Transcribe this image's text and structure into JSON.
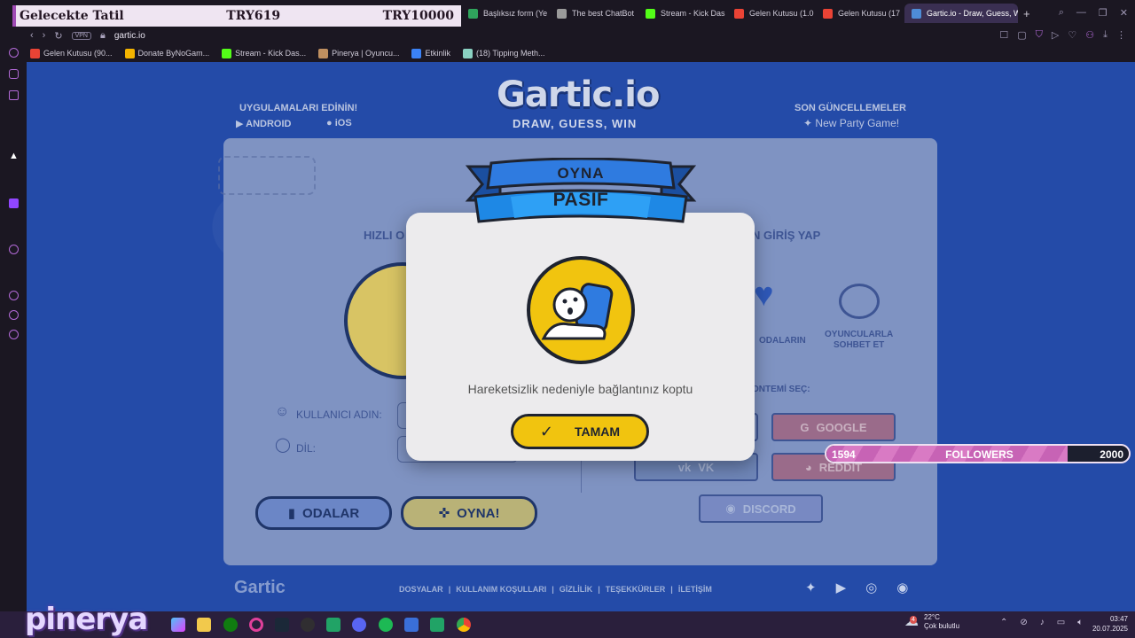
{
  "browser": {
    "tabs": [
      {
        "label": "Başlıksız form (Ye",
        "color": "#2fa45c"
      },
      {
        "label": "The best ChatBot",
        "color": "#9a9a9a"
      },
      {
        "label": "Stream - Kick Das",
        "color": "#53fc18"
      },
      {
        "label": "Gelen Kutusu (1.0",
        "color": "#ea4335"
      },
      {
        "label": "Gelen Kutusu (17",
        "color": "#ea4335"
      },
      {
        "label": "Gartic.io - Draw, Guess, W",
        "color": "#4e8cd6"
      }
    ],
    "url": "gartic.io",
    "vpn_label": "VPN",
    "bookmarks": [
      {
        "label": "Gelen Kutusu (90...",
        "color": "#ea4335"
      },
      {
        "label": "Donate ByNoGam...",
        "color": "#f4b400"
      },
      {
        "label": "Stream - Kick Das...",
        "color": "#53fc18"
      },
      {
        "label": "Pinerya | Oyuncu...",
        "color": "#c09060"
      },
      {
        "label": "Etkinlik",
        "color": "#3b82f6"
      },
      {
        "label": "(18) Tipping Meth...",
        "color": "#8ad1c2"
      }
    ]
  },
  "donation": {
    "name": "Gelecekte Tatil",
    "amount": "TRY619",
    "goal": "TRY10000"
  },
  "gartic": {
    "logo": "Gartic.io",
    "tagline": "DRAW, GUESS, WIN",
    "apps_heading": "UYGULAMALARI EDİNİN!",
    "android_label": "ANDROID",
    "ios_label": "iOS",
    "updates_heading": "SON GÜNCELLEMELER",
    "update_item": "New Party Game!",
    "quick_play": "HIZLI O",
    "login_heading": "N GİRİŞ YAP",
    "rooms_label": "ODALARIN",
    "chat_label_1": "OYUNCULARLA",
    "chat_label_2": "SOHBET ET",
    "method_label": "ONTEMİ SEÇ:",
    "username_label": "KULLANICI ADIN:",
    "language_label": "DİL:",
    "rooms_button": "ODALAR",
    "play_button": "OYNA!",
    "google_button": "GOOGLE",
    "vk_button": "VK",
    "reddit_button": "REDDIT",
    "discord_button": "DISCORD",
    "footer_logo": "Gartic",
    "footer_links": [
      "DOSYALAR",
      "|",
      "KULLANIM KOŞULLARI",
      "|",
      "GİZLİLİK",
      "|",
      "TEŞEKKÜRLER",
      "|",
      "İLETİŞİM"
    ]
  },
  "modal": {
    "banner_top": "OYNA",
    "banner_main": "PASIF",
    "message": "Hareketsizlik nedeniyle bağlantınız koptu",
    "ok_button": "TAMAM"
  },
  "followers": {
    "label": "FOLLOWERS",
    "current": "1594",
    "goal": "2000",
    "progress": 0.797
  },
  "overlay_brand": "pinerya",
  "taskbar": {
    "weather_temp": "22°C",
    "weather_desc": "Çok bulutlu",
    "weather_badge": "4",
    "time": "03:47",
    "date": "20.07.2025"
  },
  "colors": {
    "page_bg": "#244ba8",
    "modal_accent": "#f1c40f",
    "banner_blue": "#2f7be0"
  }
}
